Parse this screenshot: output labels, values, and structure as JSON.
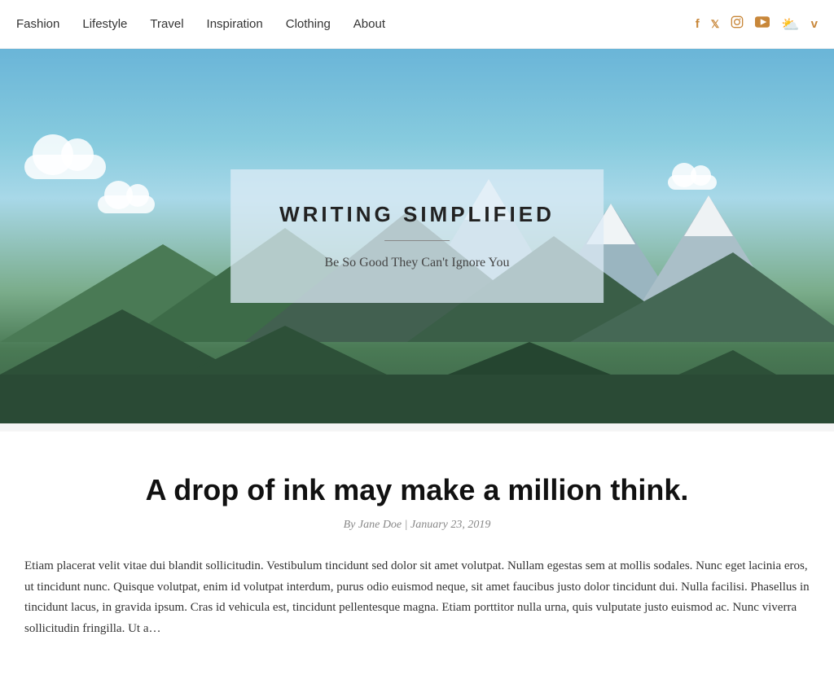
{
  "nav": {
    "links": [
      {
        "label": "Fashion",
        "id": "fashion"
      },
      {
        "label": "Lifestyle",
        "id": "lifestyle"
      },
      {
        "label": "Travel",
        "id": "travel"
      },
      {
        "label": "Inspiration",
        "id": "inspiration"
      },
      {
        "label": "Clothing",
        "id": "clothing"
      },
      {
        "label": "About",
        "id": "about"
      }
    ],
    "social_icons": [
      {
        "name": "facebook-icon",
        "glyph": "f",
        "label": "Facebook"
      },
      {
        "name": "twitter-icon",
        "glyph": "t",
        "label": "Twitter"
      },
      {
        "name": "instagram-icon",
        "glyph": "◉",
        "label": "Instagram"
      },
      {
        "name": "youtube-icon",
        "glyph": "▶",
        "label": "YouTube"
      },
      {
        "name": "soundcloud-icon",
        "glyph": "☁",
        "label": "SoundCloud"
      },
      {
        "name": "vimeo-icon",
        "glyph": "v",
        "label": "Vimeo"
      }
    ]
  },
  "hero": {
    "title": "WRITING SIMPLIFIED",
    "subtitle": "Be So Good They Can't Ignore You"
  },
  "article": {
    "title": "A drop of ink may make a million think.",
    "meta": "By Jane Doe | January 23, 2019",
    "body": "Etiam placerat velit vitae dui blandit sollicitudin. Vestibulum tincidunt sed dolor sit amet volutpat. Nullam egestas sem at mollis sodales. Nunc eget lacinia eros, ut tincidunt nunc. Quisque volutpat, enim id volutpat interdum, purus odio euismod neque, sit amet faucibus justo dolor tincidunt dui. Nulla facilisi. Phasellus in tincidunt lacus, in gravida ipsum. Cras id vehicula est, tincidunt pellentesque magna. Etiam porttitor nulla urna, quis vulputate justo euismod ac. Nunc viverra sollicitudin fringilla. Ut a…"
  },
  "colors": {
    "accent": "#c8873a",
    "nav_text": "#333333",
    "hero_bg": "#6ab5d8"
  }
}
